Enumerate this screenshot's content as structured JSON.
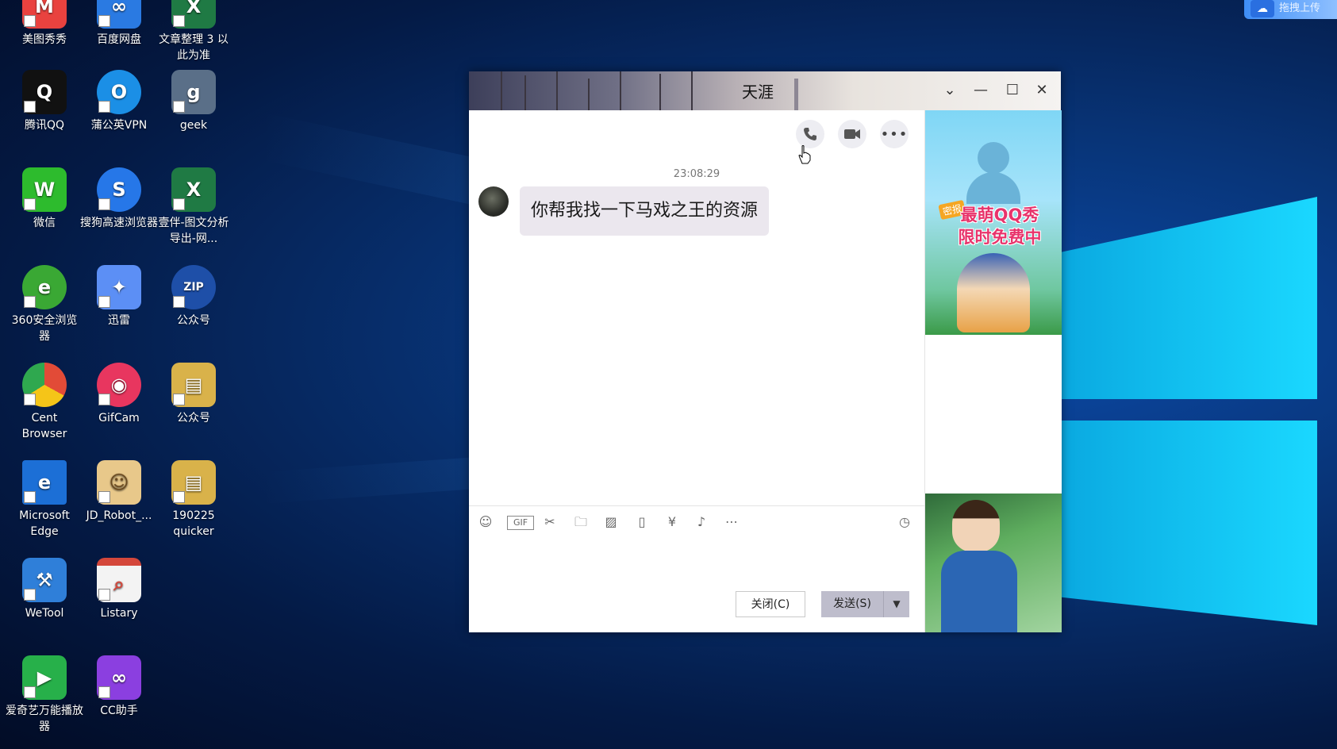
{
  "desktop": {
    "icons": [
      {
        "label": "美图秀秀",
        "color": "#e9423f",
        "glyph": "M"
      },
      {
        "label": "百度网盘",
        "color": "#2a7ae2",
        "glyph": "∞"
      },
      {
        "label": "文章整理 3 以此为准",
        "color": "#1f7a44",
        "glyph": "X"
      },
      {
        "label": "腾讯QQ",
        "color": "#111111",
        "glyph": "Q"
      },
      {
        "label": "蒲公英VPN",
        "color": "#1b8fe6",
        "glyph": "O"
      },
      {
        "label": "geek",
        "color": "#5a6f88",
        "glyph": "g"
      },
      {
        "label": "微信",
        "color": "#2dbb2d",
        "glyph": "W"
      },
      {
        "label": "搜狗高速浏览器",
        "color": "#2677e8",
        "glyph": "S"
      },
      {
        "label": "壹伴-图文分析导出-网...",
        "color": "#1f7a44",
        "glyph": "X"
      },
      {
        "label": "360安全浏览器",
        "color": "#3aa834",
        "glyph": "e"
      },
      {
        "label": "迅雷",
        "color": "#5c8ff5",
        "glyph": "✦"
      },
      {
        "label": "公众号",
        "color": "#1e4fa8",
        "glyph": "Z"
      },
      {
        "label": "Cent Browser",
        "color": "#e24b37",
        "glyph": "C"
      },
      {
        "label": "GifCam",
        "color": "#e8365f",
        "glyph": "◉"
      },
      {
        "label": "公众号",
        "color": "#d9b24a",
        "glyph": "▤"
      },
      {
        "label": "Microsoft Edge",
        "color": "#1c6fd6",
        "glyph": "e"
      },
      {
        "label": "JD_Robot_...",
        "color": "#e8c88a",
        "glyph": "☺"
      },
      {
        "label": "190225 quicker",
        "color": "#d9b24a",
        "glyph": "▤"
      },
      {
        "label": "WeTool",
        "color": "#2f7fd9",
        "glyph": "🔧"
      },
      {
        "label": "Listary",
        "color": "#d4473b",
        "glyph": "⌕"
      },
      {
        "label": "爱奇艺万能播放器",
        "color": "#27b04a",
        "glyph": "▶"
      },
      {
        "label": "CC助手",
        "color": "#8b3fe0",
        "glyph": "∞"
      }
    ]
  },
  "baidu_bar": {
    "icon": "cloud-icon",
    "label": "拖拽上传"
  },
  "chat_window": {
    "title": "天涯",
    "timestamp": "23:08:29",
    "message": "你帮我找一下马戏之王的资源",
    "toolbar": [
      "emoji-icon",
      "gif-icon",
      "screenshot-icon",
      "folder-icon",
      "image-icon",
      "shake-icon",
      "red-packet-icon",
      "music-icon",
      "more-icon"
    ],
    "close_label": "关闭(C)",
    "send_label": "发送(S)",
    "ad_text_line1": "最萌QQ秀",
    "ad_text_line2": "限时免费中",
    "ad_tag": "密报"
  }
}
